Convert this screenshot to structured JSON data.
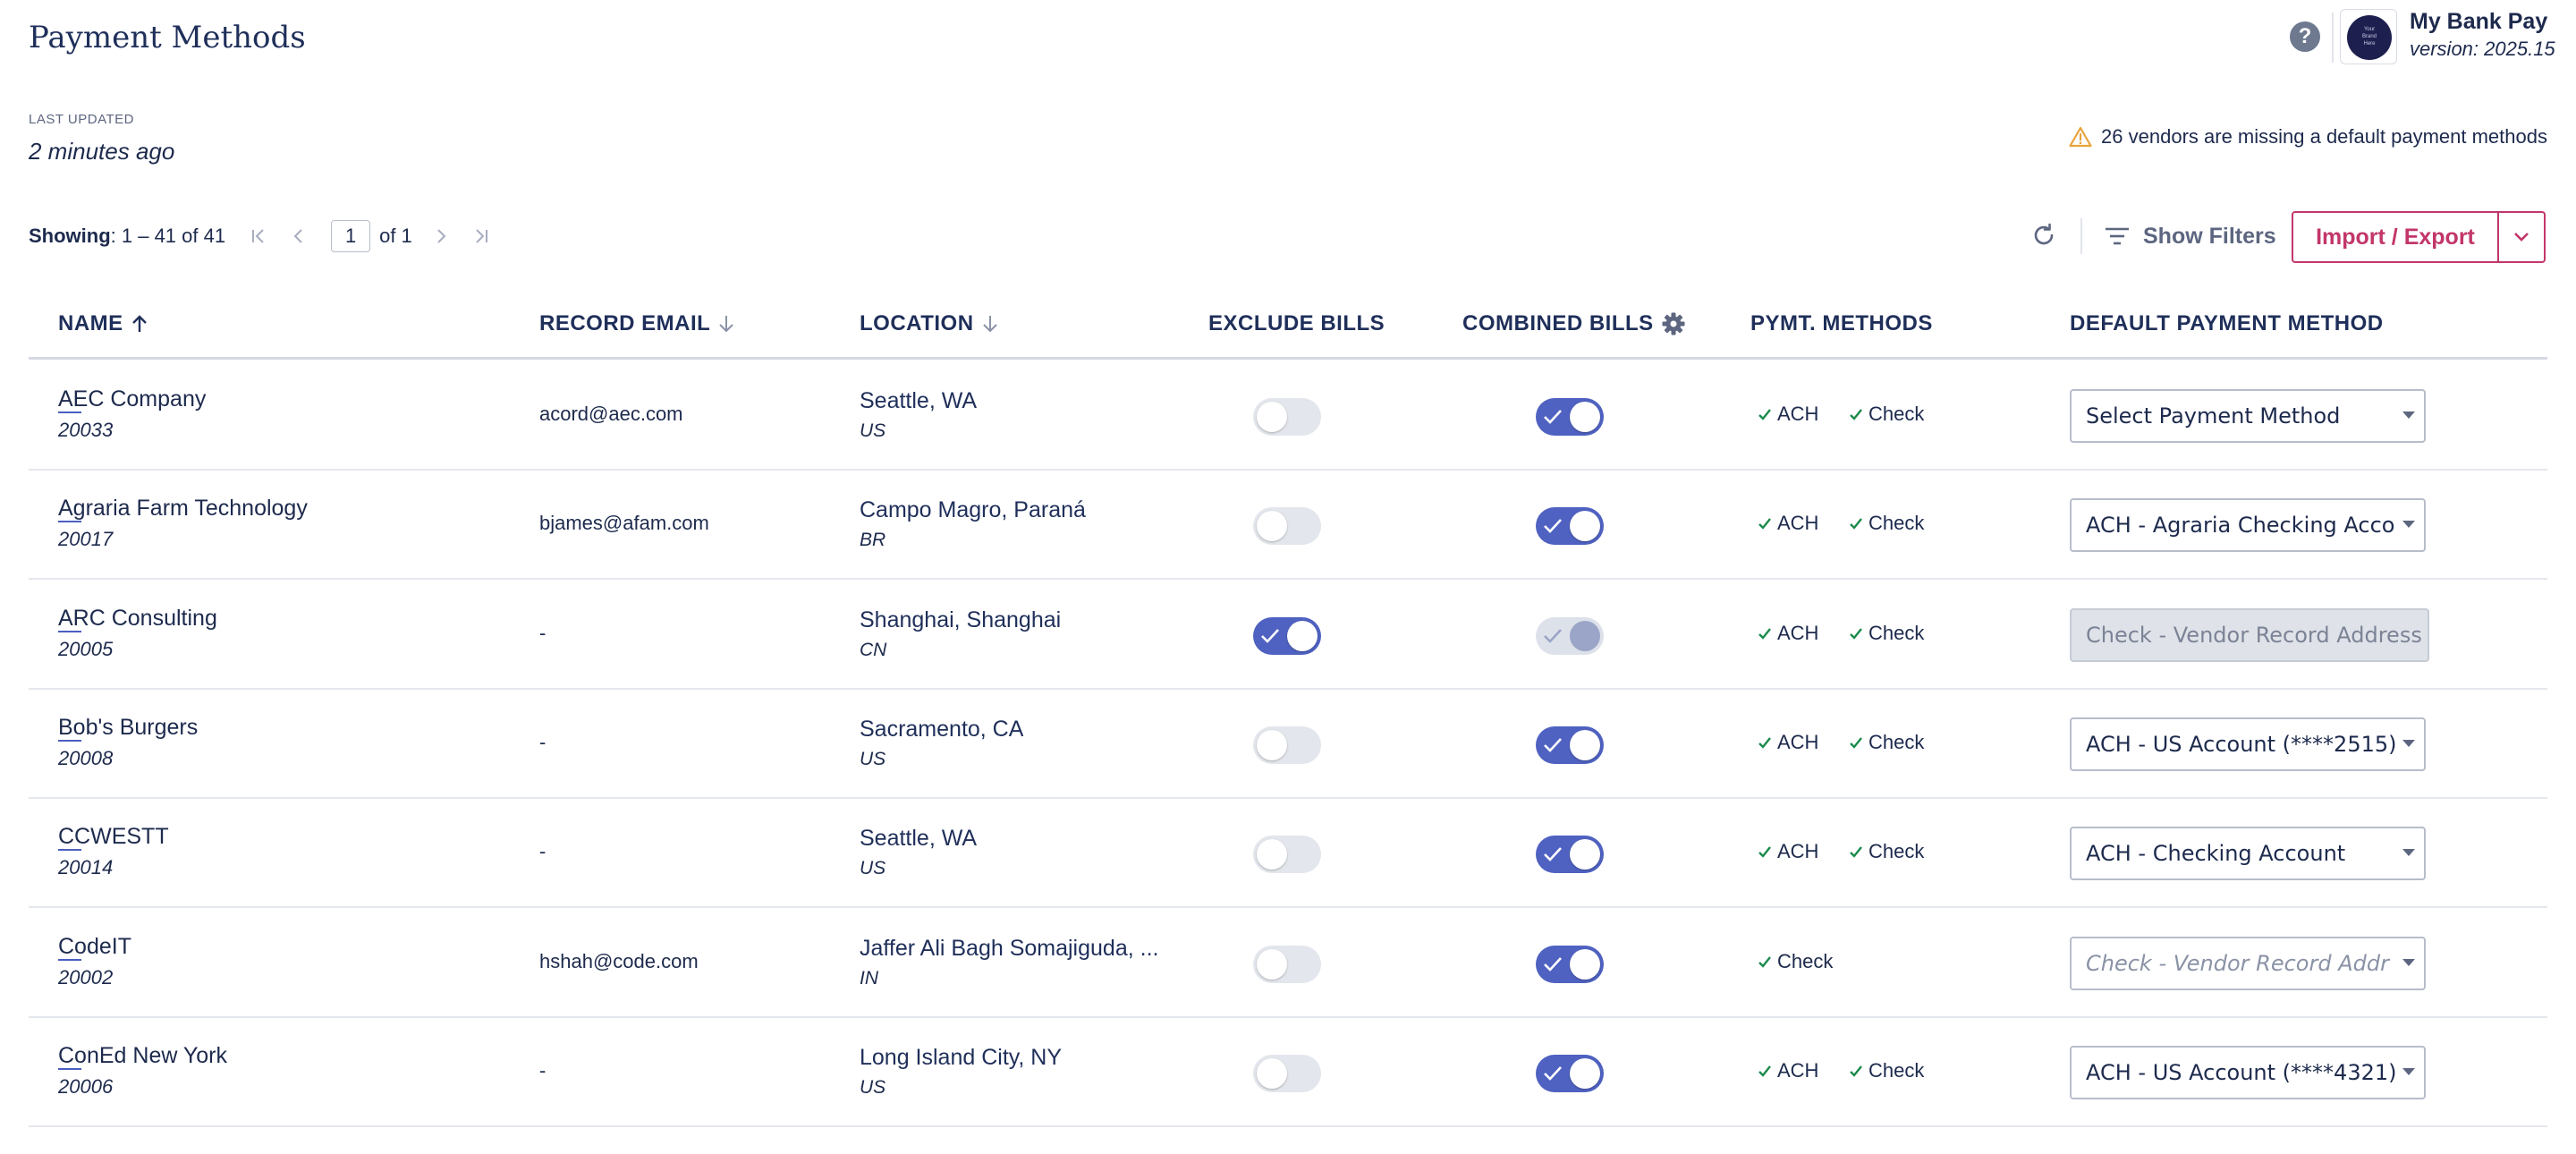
{
  "page_title": "Payment Methods",
  "app": {
    "name": "My Bank Pay",
    "version": "version: 2025.15",
    "help_icon": "question-circle-icon",
    "logo_text": "Your Brand Here"
  },
  "last_updated": {
    "label": "LAST UPDATED",
    "value": "2 minutes ago"
  },
  "warning": {
    "icon": "warning-triangle-icon",
    "text": "26 vendors are missing a default payment methods",
    "color": "#e8a33a"
  },
  "pager": {
    "showing_label": "Showing",
    "showing_value": ": 1 – 41 of 41",
    "page": "1",
    "of_label": "of 1"
  },
  "toolbar": {
    "show_filters": "Show Filters",
    "import_export": "Import / Export"
  },
  "colors": {
    "accent": "#4f62c1",
    "brand": "#c2366a",
    "check_green": "#1a8a4a",
    "header_text": "#1f2f5a"
  },
  "columns": {
    "name": "NAME",
    "record_email": "RECORD EMAIL",
    "location": "LOCATION",
    "exclude_bills": "EXCLUDE BILLS",
    "combined_bills": "COMBINED BILLS",
    "pymt_methods": "PYMT. METHODS",
    "default_payment_method": "DEFAULT PAYMENT METHOD"
  },
  "rows": [
    {
      "name": "AEC Company",
      "id": "20033",
      "email": "acord@aec.com",
      "location": "Seattle, WA",
      "country": "US",
      "exclude": false,
      "combined": true,
      "combined_disabled": false,
      "pm1": "ACH",
      "pm2": "Check",
      "default": "Select Payment Method",
      "default_state": "normal"
    },
    {
      "name": "Agraria Farm Technology",
      "id": "20017",
      "email": "bjames@afam.com",
      "location": "Campo Magro, Paraná",
      "country": "BR",
      "exclude": false,
      "combined": true,
      "combined_disabled": false,
      "pm1": "ACH",
      "pm2": "Check",
      "default": "ACH - Agraria Checking Acco",
      "default_state": "normal"
    },
    {
      "name": "ARC Consulting",
      "id": "20005",
      "email": "-",
      "location": "Shanghai, Shanghai",
      "country": "CN",
      "exclude": true,
      "combined": true,
      "combined_disabled": true,
      "pm1": "ACH",
      "pm2": "Check",
      "default": "Check - Vendor Record Address",
      "default_state": "disabled"
    },
    {
      "name": "Bob's Burgers",
      "id": "20008",
      "email": "-",
      "location": "Sacramento, CA",
      "country": "US",
      "exclude": false,
      "combined": true,
      "combined_disabled": false,
      "pm1": "ACH",
      "pm2": "Check",
      "default": "ACH - US Account (****2515)",
      "default_state": "normal"
    },
    {
      "name": "CCWESTT",
      "id": "20014",
      "email": "-",
      "location": "Seattle, WA",
      "country": "US",
      "exclude": false,
      "combined": true,
      "combined_disabled": false,
      "pm1": "ACH",
      "pm2": "Check",
      "default": "ACH - Checking Account",
      "default_state": "normal"
    },
    {
      "name": "CodeIT",
      "id": "20002",
      "email": "hshah@code.com",
      "location": "Jaffer Ali Bagh Somajiguda, ...",
      "country": "IN",
      "exclude": false,
      "combined": true,
      "combined_disabled": false,
      "pm1": "Check",
      "pm2": "",
      "default": "Check - Vendor Record Addr",
      "default_state": "placeholder"
    },
    {
      "name": "ConEd New York",
      "id": "20006",
      "email": "-",
      "location": "Long Island City, NY",
      "country": "US",
      "exclude": false,
      "combined": true,
      "combined_disabled": false,
      "pm1": "ACH",
      "pm2": "Check",
      "default": "ACH - US Account (****4321)",
      "default_state": "normal"
    }
  ]
}
